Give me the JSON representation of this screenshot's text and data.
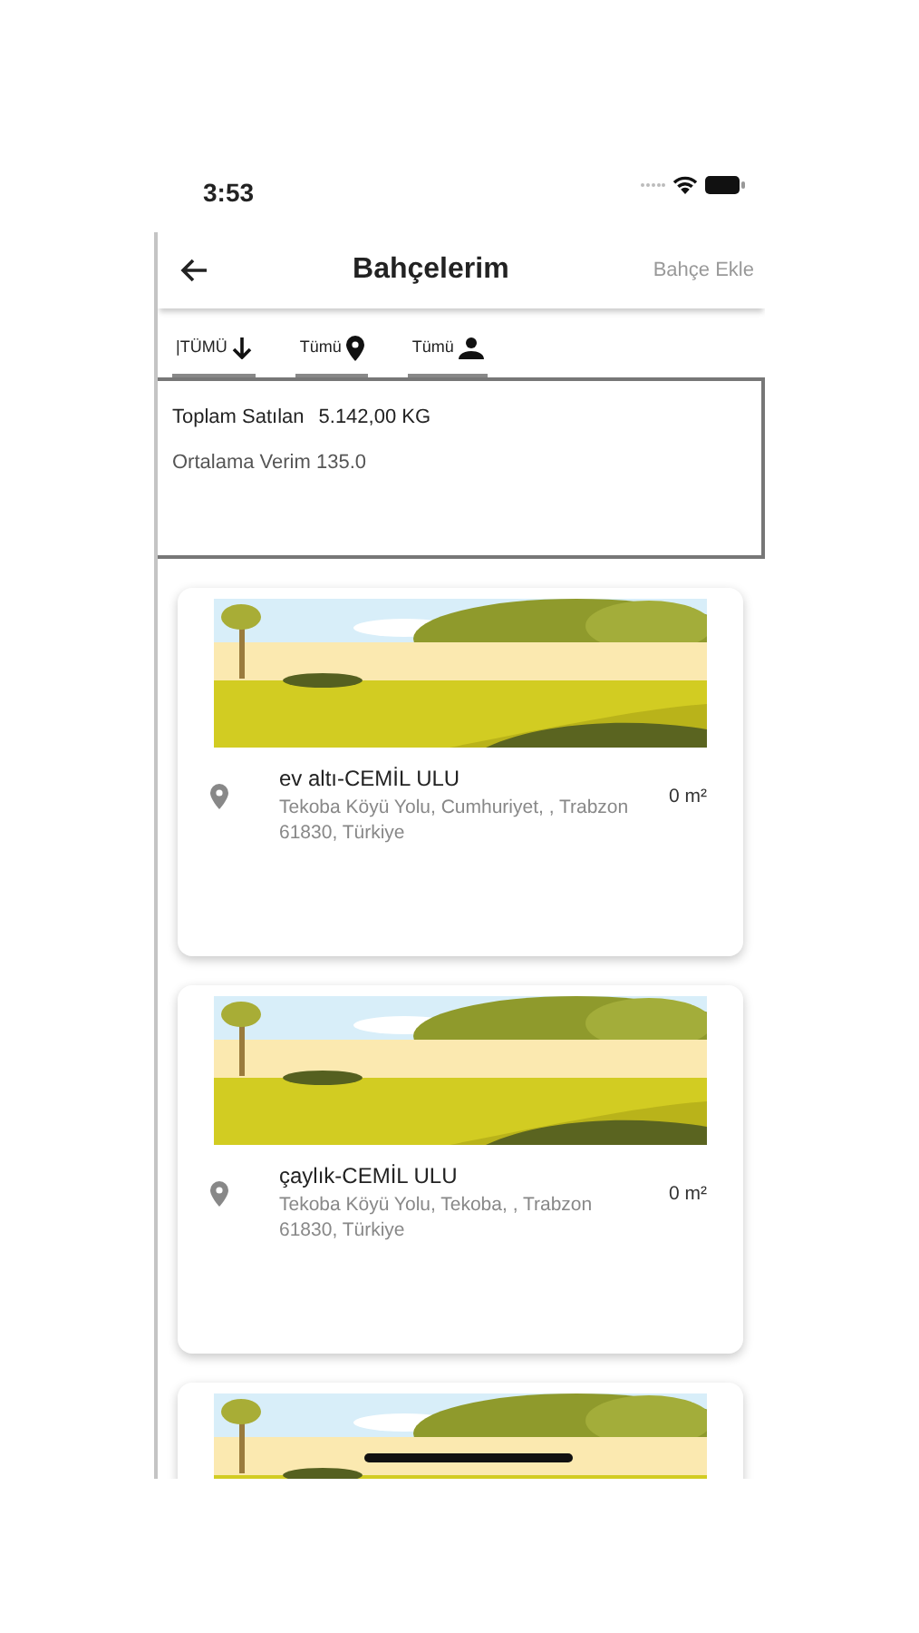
{
  "status_bar": {
    "time": "3:53"
  },
  "header": {
    "title": "Bahçelerim",
    "action": "Bahçe Ekle"
  },
  "filters": [
    {
      "label": "|TÜMÜ",
      "kind": "sort"
    },
    {
      "label": "Tümü",
      "kind": "location"
    },
    {
      "label": "Tümü",
      "kind": "person"
    }
  ],
  "summary": {
    "total_label": "Toplam Satılan",
    "total_value": "5.142,00 KG",
    "average": "Ortalama Verim 135.0"
  },
  "gardens": [
    {
      "kind": "full",
      "name": "ev altı-CEMİL ULU",
      "address": "Tekoba Köyü Yolu, Cumhuriyet, , Trabzon 61830, Türkiye",
      "area": "0 m²"
    },
    {
      "kind": "full",
      "name": "çaylık-CEMİL ULU",
      "address": "Tekoba Köyü Yolu, Tekoba, , Trabzon 61830, Türkiye",
      "area": "0 m²"
    },
    {
      "kind": "cut"
    }
  ]
}
